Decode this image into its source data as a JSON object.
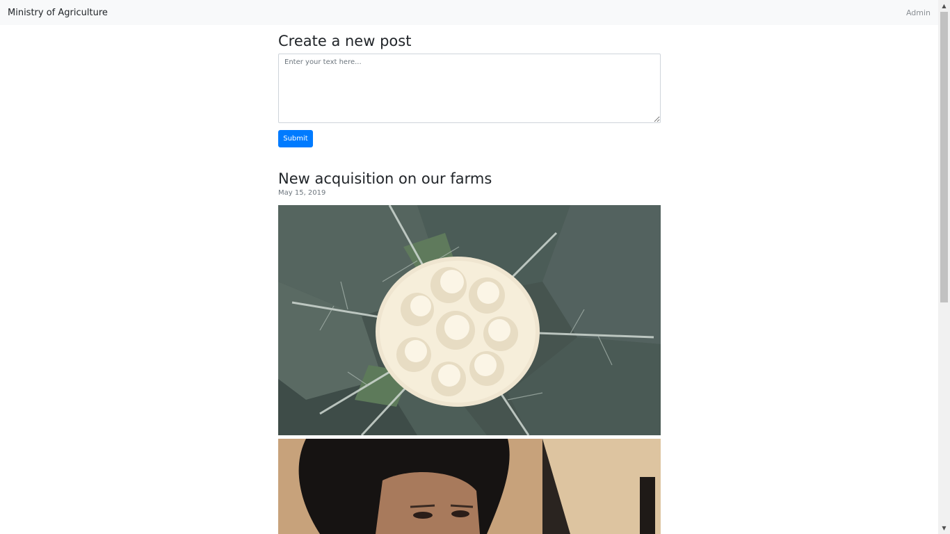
{
  "navbar": {
    "brand": "Ministry of Agriculture",
    "admin_link": "Admin"
  },
  "composer": {
    "title": "Create a new post",
    "placeholder": "Enter your text here...",
    "submit_label": "Submit"
  },
  "posts": [
    {
      "title": "New acquisition on our farms",
      "date": "May 15, 2019",
      "images": [
        {
          "subject": "cauliflower-photo"
        },
        {
          "subject": "portrait-photo"
        }
      ]
    }
  ],
  "colors": {
    "navbar_bg": "#f8f9fa",
    "primary": "#007bff",
    "text": "#212529",
    "muted": "#6c757d"
  }
}
